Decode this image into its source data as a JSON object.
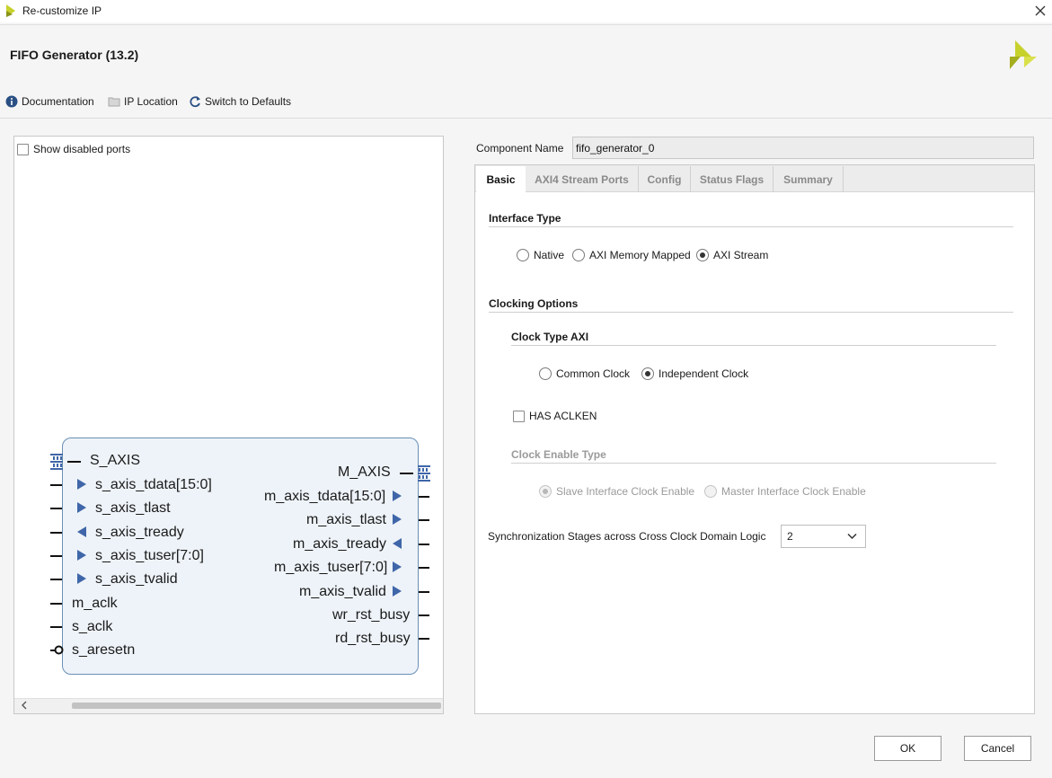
{
  "window": {
    "title": "Re-customize IP"
  },
  "header": {
    "ip_title": "FIFO Generator (13.2)"
  },
  "toolbar": {
    "documentation": "Documentation",
    "ip_location": "IP Location",
    "switch_defaults": "Switch to Defaults"
  },
  "left_panel": {
    "show_disabled_ports": "Show disabled ports"
  },
  "symbol": {
    "left_bus": "S_AXIS",
    "right_bus": "M_AXIS",
    "left_ports": [
      {
        "name": "s_axis_tdata[15:0]",
        "dir": "in"
      },
      {
        "name": "s_axis_tlast",
        "dir": "in"
      },
      {
        "name": "s_axis_tready",
        "dir": "out"
      },
      {
        "name": "s_axis_tuser[7:0]",
        "dir": "in"
      },
      {
        "name": "s_axis_tvalid",
        "dir": "in"
      },
      {
        "name": "m_aclk",
        "dir": "clk"
      },
      {
        "name": "s_aclk",
        "dir": "clk"
      },
      {
        "name": "s_aresetn",
        "dir": "reset"
      }
    ],
    "right_ports": [
      {
        "name": "m_axis_tdata[15:0]",
        "dir": "out"
      },
      {
        "name": "m_axis_tlast",
        "dir": "out"
      },
      {
        "name": "m_axis_tready",
        "dir": "in"
      },
      {
        "name": "m_axis_tuser[7:0]",
        "dir": "out"
      },
      {
        "name": "m_axis_tvalid",
        "dir": "out"
      },
      {
        "name": "wr_rst_busy",
        "dir": "plain"
      },
      {
        "name": "rd_rst_busy",
        "dir": "plain"
      }
    ]
  },
  "component": {
    "label": "Component Name",
    "value": "fifo_generator_0"
  },
  "tabs": [
    {
      "label": "Basic",
      "active": true
    },
    {
      "label": "AXI4 Stream Ports",
      "active": false
    },
    {
      "label": "Config",
      "active": false
    },
    {
      "label": "Status Flags",
      "active": false
    },
    {
      "label": "Summary",
      "active": false
    }
  ],
  "basic": {
    "interface_type_title": "Interface Type",
    "interface_options": [
      "Native",
      "AXI Memory Mapped",
      "AXI Stream"
    ],
    "interface_selected": "AXI Stream",
    "clocking_title": "Clocking Options",
    "clock_type_title": "Clock Type AXI",
    "clock_options": [
      "Common Clock",
      "Independent Clock"
    ],
    "clock_selected": "Independent Clock",
    "has_aclken_label": "HAS ACLKEN",
    "has_aclken_checked": false,
    "clock_enable_title": "Clock Enable Type",
    "clock_enable_options": [
      "Slave Interface Clock Enable",
      "Master Interface Clock Enable"
    ],
    "clock_enable_selected": "Slave Interface Clock Enable",
    "sync_label": "Synchronization Stages across Cross Clock Domain Logic",
    "sync_value": "2"
  },
  "footer": {
    "ok": "OK",
    "cancel": "Cancel"
  },
  "colors": {
    "accent": "#3f66a8",
    "symbol_fill": "#eef3f9",
    "symbol_border": "#6a8fb4",
    "logo_yellow": "#c7d12c"
  }
}
